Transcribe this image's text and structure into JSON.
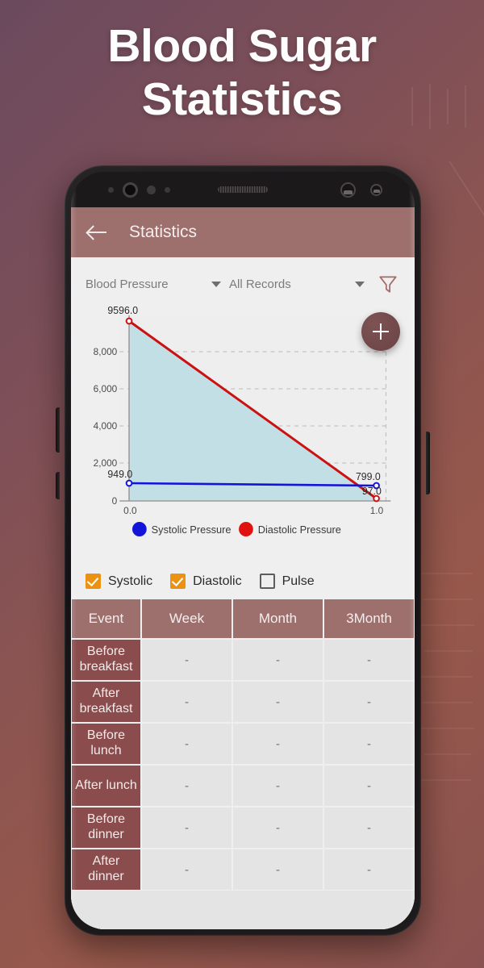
{
  "hero": {
    "line1": "Blood Sugar",
    "line2": "Statistics"
  },
  "appbar": {
    "back_icon": "back-arrow-icon",
    "title": "Statistics"
  },
  "filters": {
    "metric": {
      "value": "Blood Pressure",
      "caret_icon": "chevron-down-icon"
    },
    "range": {
      "value": "All Records",
      "caret_icon": "chevron-down-icon"
    },
    "funnel_icon": "filter-funnel-icon"
  },
  "fab": {
    "icon": "plus-icon",
    "label": "+",
    "color": "#6f4749"
  },
  "chart_data": {
    "type": "line",
    "title": "",
    "xlabel": "",
    "ylabel": "",
    "x": [
      0.0,
      1.0
    ],
    "xlim": [
      0.0,
      1.0
    ],
    "ylim": [
      0,
      9596
    ],
    "x_ticks": [
      "0.0",
      "1.0"
    ],
    "y_ticks": [
      "0",
      "2,000",
      "4,000",
      "6,000",
      "8,000"
    ],
    "y_tick_values": [
      0,
      2000,
      4000,
      6000,
      8000
    ],
    "grid": true,
    "legend_position": "bottom",
    "series": [
      {
        "name": "Diastolic Pressure",
        "color": "#cc1111",
        "values": [
          9596.0,
          97.0
        ],
        "point_labels": [
          "9596.0",
          "97.0"
        ],
        "filled": true,
        "fill_color": "#bfdde5"
      },
      {
        "name": "Systolic Pressure",
        "color": "#1414d8",
        "values": [
          949.0,
          799.0
        ],
        "point_labels": [
          "949.0",
          "799.0"
        ],
        "filled": false
      }
    ]
  },
  "checkboxes": [
    {
      "label": "Systolic",
      "checked": true
    },
    {
      "label": "Diastolic",
      "checked": true
    },
    {
      "label": "Pulse",
      "checked": false
    }
  ],
  "table": {
    "headers": [
      "Event",
      "Week",
      "Month",
      "3Month"
    ],
    "rows": [
      {
        "event": "Before breakfast",
        "week": "-",
        "month": "-",
        "month3": "-"
      },
      {
        "event": "After breakfast",
        "week": "-",
        "month": "-",
        "month3": "-"
      },
      {
        "event": "Before lunch",
        "week": "-",
        "month": "-",
        "month3": "-"
      },
      {
        "event": "After lunch",
        "week": "-",
        "month": "-",
        "month3": "-"
      },
      {
        "event": "Before dinner",
        "week": "-",
        "month": "-",
        "month3": "-"
      },
      {
        "event": "After dinner",
        "week": "-",
        "month": "-",
        "month3": "-"
      }
    ]
  },
  "theme": {
    "accent": "#9d6f6d",
    "table_row_header": "#8a4c4c",
    "checkbox": "#eb9212"
  }
}
